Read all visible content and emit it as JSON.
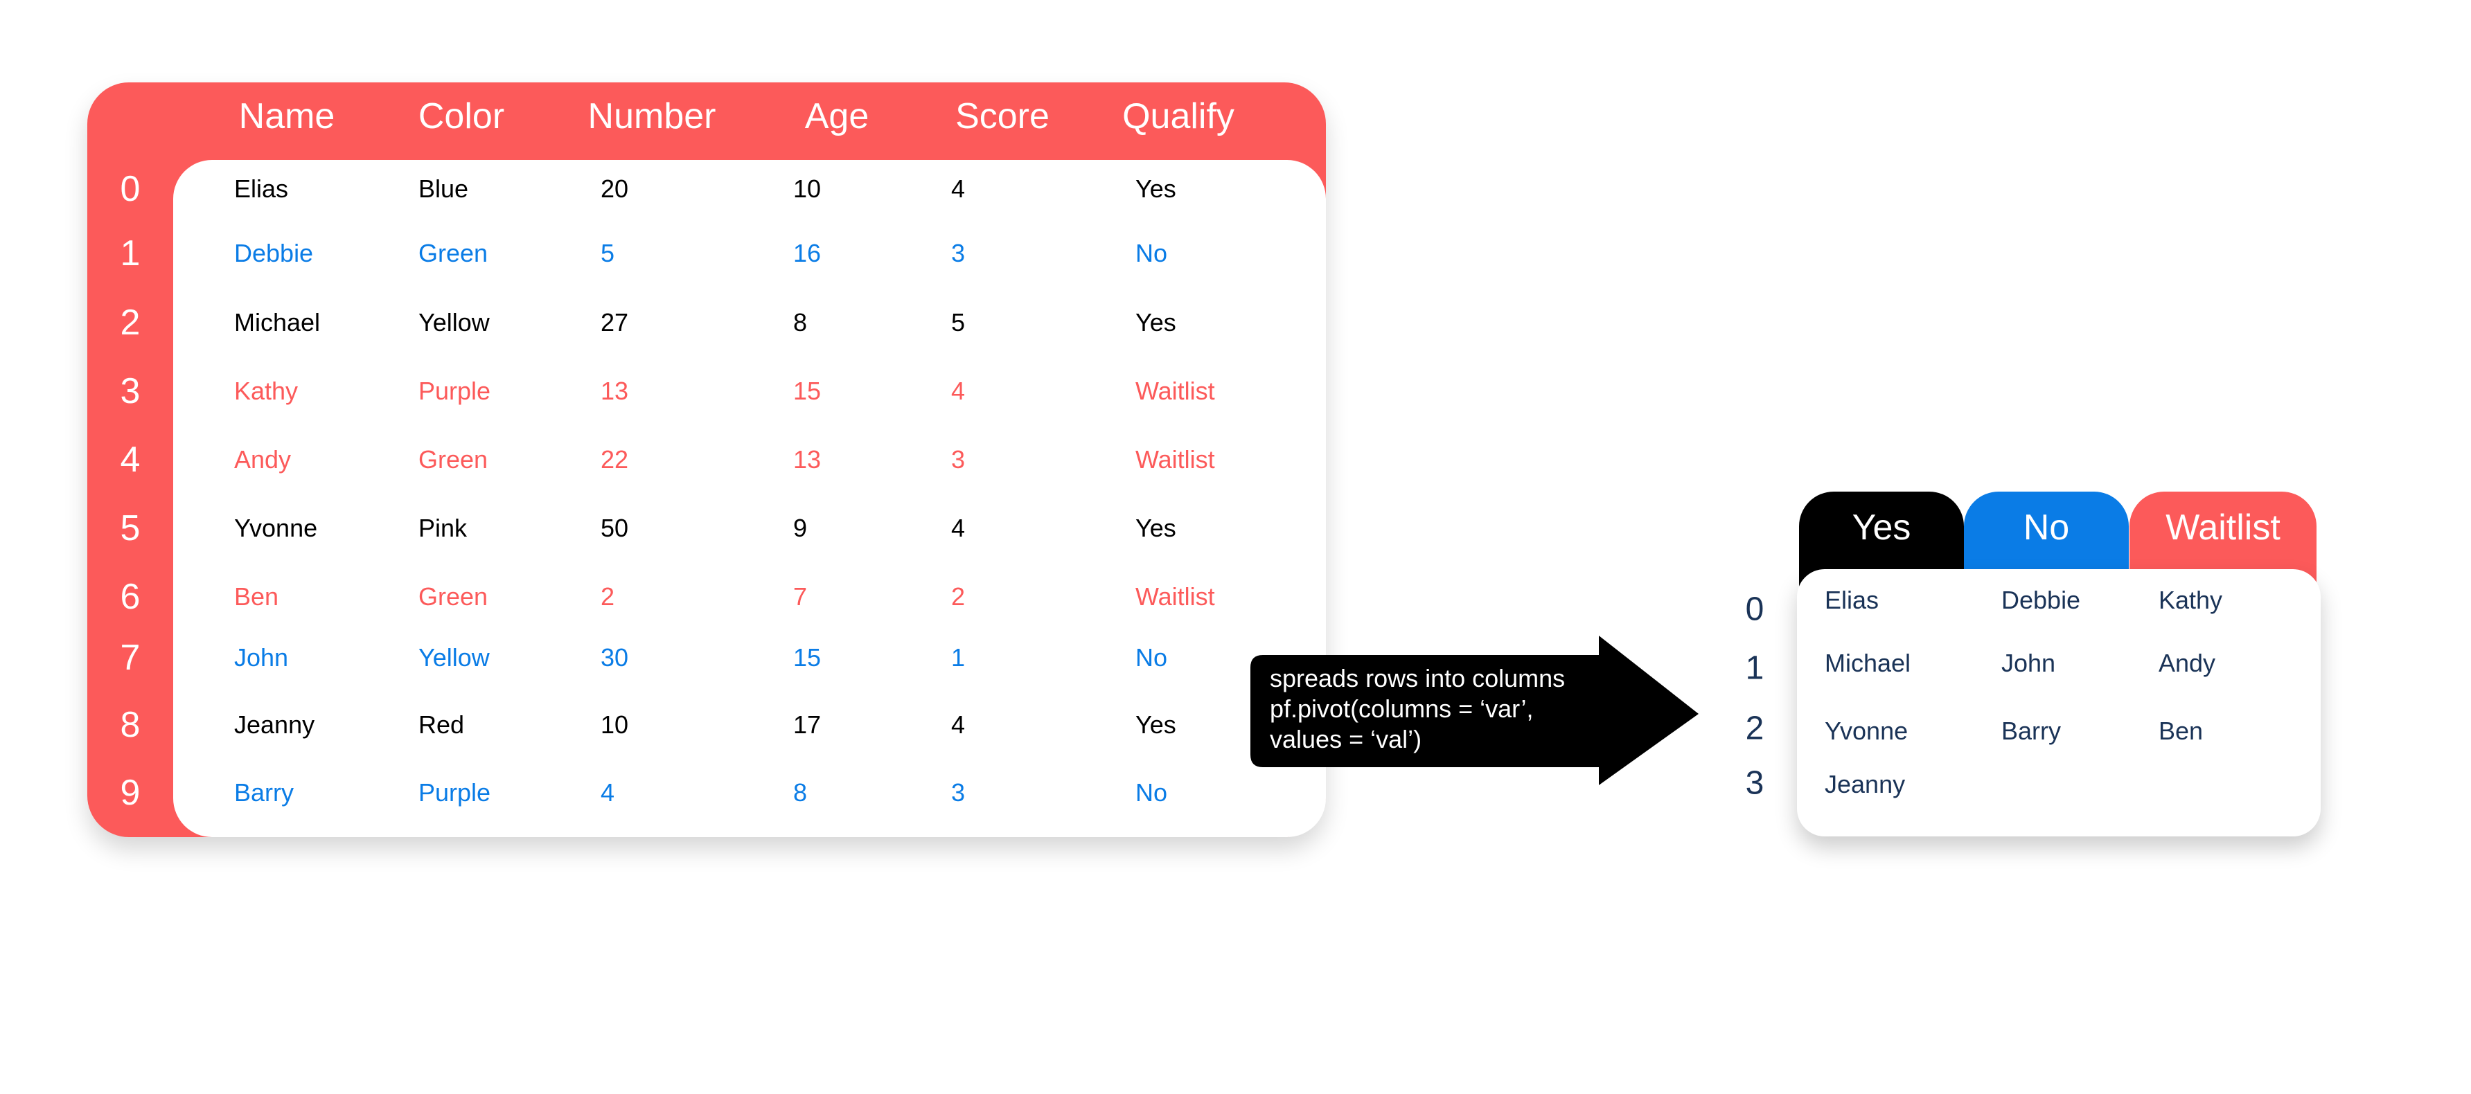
{
  "source_table": {
    "columns": [
      "Name",
      "Color",
      "Number",
      "Age",
      "Score",
      "Qualify"
    ],
    "index": [
      "0",
      "1",
      "2",
      "3",
      "4",
      "5",
      "6",
      "7",
      "8",
      "9"
    ],
    "rows": [
      [
        "Elias",
        "Blue",
        "20",
        "10",
        "4",
        "Yes"
      ],
      [
        "Debbie",
        "Green",
        "5",
        "16",
        "3",
        "No"
      ],
      [
        "Michael",
        "Yellow",
        "27",
        "8",
        "5",
        "Yes"
      ],
      [
        "Kathy",
        "Purple",
        "13",
        "15",
        "4",
        "Waitlist"
      ],
      [
        "Andy",
        "Green",
        "22",
        "13",
        "3",
        "Waitlist"
      ],
      [
        "Yvonne",
        "Pink",
        "50",
        "9",
        "4",
        "Yes"
      ],
      [
        "Ben",
        "Green",
        "2",
        "7",
        "2",
        "Waitlist"
      ],
      [
        "John",
        "Yellow",
        "30",
        "15",
        "1",
        "No"
      ],
      [
        "Jeanny",
        "Red",
        "10",
        "17",
        "4",
        "Yes"
      ],
      [
        "Barry",
        "Purple",
        "4",
        "8",
        "3",
        "No"
      ]
    ]
  },
  "arrow": {
    "lines": [
      "spreads rows into columns",
      "pf.pivot(columns = ‘var’,",
      "values = ‘val’)"
    ]
  },
  "pivot_table": {
    "columns": [
      "Yes",
      "No",
      "Waitlist"
    ],
    "index": [
      "0",
      "1",
      "2",
      "3"
    ],
    "rows": [
      [
        "Elias",
        "Debbie",
        "Kathy"
      ],
      [
        "Michael",
        "John",
        "Andy"
      ],
      [
        "Yvonne",
        "Barry",
        "Ben"
      ],
      [
        "Jeanny",
        "",
        ""
      ]
    ]
  },
  "colors": {
    "Yes": "#000000",
    "No": "#0a7ce6",
    "Waitlist": "#fc5a5a",
    "table_frame": "#fc5a5a",
    "arrow": "#000000",
    "pivot_text": "#1a3357"
  }
}
